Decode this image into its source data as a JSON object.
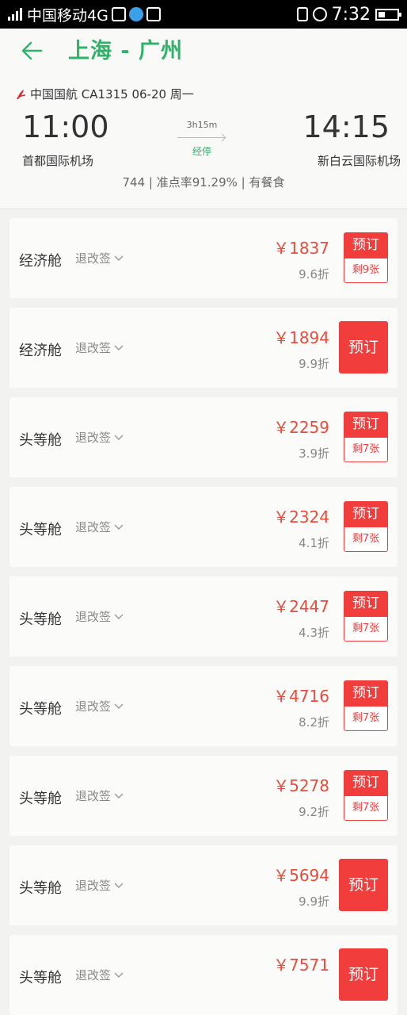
{
  "status_bar": {
    "network": "中国移动4G",
    "time": "7:32",
    "network_badge": "4G"
  },
  "header": {
    "route_title": "上海 - 广州",
    "airline": "中国国航 CA1315 06-20 周一",
    "dep_time": "11:00",
    "arr_time": "14:15",
    "duration": "3h15m",
    "stop": "经停",
    "dep_airport": "首都国际机场",
    "arr_airport": "新白云国际机场",
    "info": "744 | 准点率91.29% | 有餐食"
  },
  "refund_label": "退改签",
  "book_label": "预订",
  "fares": [
    {
      "cabin": "经济舱",
      "price": "￥1837",
      "discount": "9.6折",
      "remain": "剩9张"
    },
    {
      "cabin": "经济舱",
      "price": "￥1894",
      "discount": "9.9折",
      "remain": ""
    },
    {
      "cabin": "头等舱",
      "price": "￥2259",
      "discount": "3.9折",
      "remain": "剩7张"
    },
    {
      "cabin": "头等舱",
      "price": "￥2324",
      "discount": "4.1折",
      "remain": "剩7张"
    },
    {
      "cabin": "头等舱",
      "price": "￥2447",
      "discount": "4.3折",
      "remain": "剩7张"
    },
    {
      "cabin": "头等舱",
      "price": "￥4716",
      "discount": "8.2折",
      "remain": "剩7张"
    },
    {
      "cabin": "头等舱",
      "price": "￥5278",
      "discount": "9.2折",
      "remain": "剩7张"
    },
    {
      "cabin": "头等舱",
      "price": "￥5694",
      "discount": "9.9折",
      "remain": ""
    },
    {
      "cabin": "头等舱",
      "price": "￥7571",
      "discount": "",
      "remain": ""
    }
  ],
  "colors": {
    "accent": "#2fb36a",
    "price": "#e74c3c",
    "button": "#f23d3d"
  }
}
